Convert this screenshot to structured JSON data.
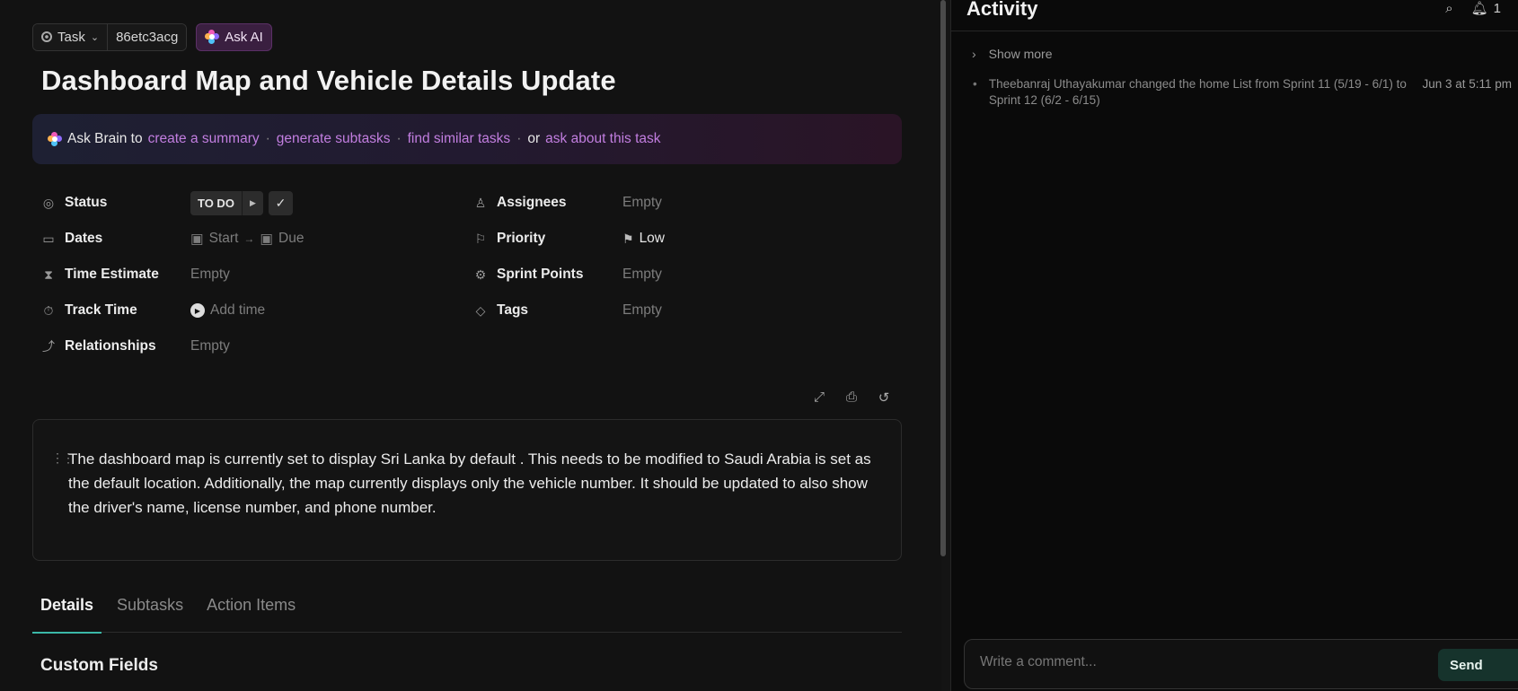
{
  "topbar": {
    "type_label": "Task",
    "task_id": "86etc3acg",
    "ask_ai_label": "Ask AI"
  },
  "task": {
    "title": "Dashboard Map and Vehicle Details Update"
  },
  "brain": {
    "prefix": "Ask Brain to",
    "link_summary": "create a summary",
    "link_subtasks": "generate subtasks",
    "link_similar": "find similar tasks",
    "or_text": "or",
    "link_ask": "ask about this task",
    "sep": "·"
  },
  "fields": {
    "status": {
      "label": "Status",
      "value": "TO DO"
    },
    "dates": {
      "label": "Dates",
      "start": "Start",
      "due": "Due"
    },
    "time_estimate": {
      "label": "Time Estimate",
      "value": "Empty"
    },
    "track_time": {
      "label": "Track Time",
      "value": "Add time"
    },
    "relationships": {
      "label": "Relationships",
      "value": "Empty"
    },
    "assignees": {
      "label": "Assignees",
      "value": "Empty"
    },
    "priority": {
      "label": "Priority",
      "value": "Low"
    },
    "sprint_points": {
      "label": "Sprint Points",
      "value": "Empty"
    },
    "tags": {
      "label": "Tags",
      "value": "Empty"
    }
  },
  "description": {
    "text": "The dashboard map is currently set to display Sri Lanka by default . This needs to be modified to Saudi Arabia is set as the default location. Additionally, the map currently displays only the vehicle number. It should be updated to also show the driver's name, license number, and phone number."
  },
  "tabs": {
    "details": "Details",
    "subtasks": "Subtasks",
    "action_items": "Action Items"
  },
  "custom_fields": {
    "heading": "Custom Fields"
  },
  "activity": {
    "title": "Activity",
    "notification_count": "1",
    "show_more": "Show more",
    "items": [
      {
        "message": "Theebanraj Uthayakumar changed the home List from Sprint 11 (5/19 - 6/1) to Sprint 12 (6/2 - 6/15)",
        "time": "Jun 3 at 5:11 pm"
      }
    ]
  },
  "comment": {
    "placeholder": "Write a comment...",
    "send_label": "Send"
  },
  "colors": {
    "accent_teal": "#3bb8a8",
    "brain_link": "#c27ee0",
    "ask_ai_bg": "#3a1f40"
  }
}
